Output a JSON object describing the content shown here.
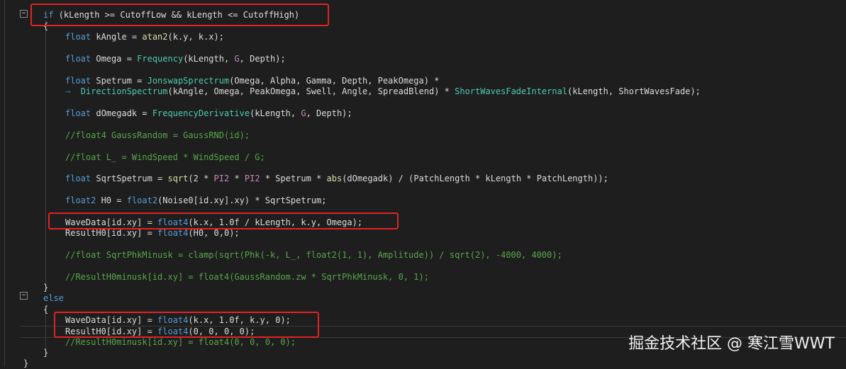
{
  "code_lines": [
    {
      "html": "<span class='kw'>if</span> (kLength &gt;= CutoffLow &amp;&amp; kLength &lt;= CutoffHigh)"
    },
    {
      "html": "{"
    },
    {
      "html": "<span class='type'>float</span> kAngle = <span class='fn2'>atan2</span>(k.y, k.x);"
    },
    {
      "html": ""
    },
    {
      "html": "<span class='type'>float</span> Omega = <span class='fn'>Frequency</span>(kLength, <span class='const'>G</span>, Depth);"
    },
    {
      "html": ""
    },
    {
      "html": "<span class='type'>float</span> Spetrum = <span class='fn'>JonswapSprectrum</span>(Omega, Alpha, Gamma, Depth, PeakOmega) *"
    },
    {
      "html": "  <span class='fn'>DirectionSpectrum</span>(kAngle, Omega, PeakOmega, Swell, Angle, SpreadBlend) * <span class='fn'>ShortWavesFadeInternal</span>(kLength, ShortWavesFade);"
    },
    {
      "html": ""
    },
    {
      "html": "<span class='type'>float</span> dOmegadk = <span class='fn'>FrequencyDerivative</span>(kLength, <span class='const'>G</span>, Depth);"
    },
    {
      "html": ""
    },
    {
      "html": "<span class='cm'>//float4 GaussRandom = GaussRND(id);</span>"
    },
    {
      "html": ""
    },
    {
      "html": "<span class='cm'>//float L_ = WindSpeed * WindSpeed / G;</span>"
    },
    {
      "html": ""
    },
    {
      "html": "<span class='type'>float</span> SqrtSpetrum = <span class='fn2'>sqrt</span>(2 * <span class='const'>PI2</span> * <span class='const'>PI2</span> * Spetrum * <span class='fn2'>abs</span>(dOmegadk) / (PatchLength * kLength * PatchLength));"
    },
    {
      "html": ""
    },
    {
      "html": "<span class='type'>float2</span> H0 = <span class='type'>float2</span>(Noise0[id.xy].xy) * SqrtSpetrum;"
    },
    {
      "html": ""
    },
    {
      "html": "WaveData[id.xy] = <span class='type'>float4</span>(k.x, 1.0f / kLength, k.y, Omega);"
    },
    {
      "html": "ResultH0[id.xy] = <span class='type'>float4</span>(H0, 0,0);"
    },
    {
      "html": ""
    },
    {
      "html": "<span class='cm'>//float SqrtPhkMinusk = clamp(sqrt(Phk(-k, L_, float2(1, 1), Amplitude)) / sqrt(2), -4000, 4000);</span>"
    },
    {
      "html": ""
    },
    {
      "html": "<span class='cm'>//ResultH0minusk[id.xy] = float4(GaussRandom.zw * SqrtPhkMinusk, 0, 1);</span>"
    },
    {
      "html": "}"
    },
    {
      "html": "<span class='kw'>else</span>"
    },
    {
      "html": "{"
    },
    {
      "html": "WaveData[id.xy] = <span class='type'>float4</span>(k.x, 1.0f, k.y, 0);"
    },
    {
      "html": "ResultH0[id.xy] = <span class='type'>float4</span>(0, 0, 0, 0);"
    },
    {
      "html": "<span class='cm'>//ResultH0minusk[id.xy] = float4(0, 0, 0, 0);</span>"
    },
    {
      "html": "}"
    },
    {
      "html": "}"
    }
  ],
  "watermark": "掘金技术社区 @ 寒江雪WWT"
}
